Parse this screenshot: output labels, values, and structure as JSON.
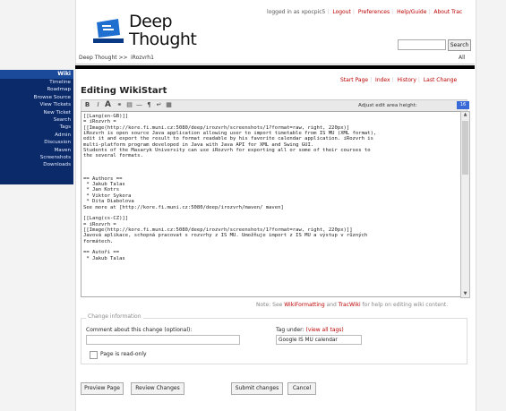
{
  "brand": {
    "line1": "Deep",
    "line2": "Thought"
  },
  "metanav": {
    "logged_in": "logged in as xpocpic5",
    "links": [
      "Logout",
      "Preferences",
      "Help/Guide",
      "About Trac"
    ]
  },
  "search": {
    "button": "Search"
  },
  "breadcrumb": {
    "first": "Deep Thought >>",
    "second": "iRozvrh1"
  },
  "all_button": "All",
  "sidebar": {
    "title": "Wiki",
    "items": [
      "Timeline",
      "Roadmap",
      "Browse Source",
      "View Tickets",
      "New Ticket",
      "Search",
      "Tags",
      "Admin",
      "Discussion",
      "Maven",
      "Screenshots",
      "Downloads"
    ]
  },
  "context_links": [
    "Start Page",
    "Index",
    "History",
    "Last Change"
  ],
  "page_title": "Editing WikiStart",
  "toolbar": {
    "icons": [
      "bold-icon",
      "italic-icon",
      "heading-icon",
      "link-icon",
      "code-icon",
      "hr-icon",
      "paragraph-icon",
      "linebreak-icon",
      "image-icon"
    ]
  },
  "adjust_label": "Adjust edit area height:",
  "adjust_value": "16",
  "editor_text": "[[Lang(en-GB)]]\n= iRozvrh =\n[[Image(http://kore.fi.muni.cz:5080/deep/irozvrh/screenshots/1?format=raw, right, 220px)]\niRozvrh is open source Java application allowing user to import timetable from IS MU (XML format),\nedit it and export the result to format readable by his favorite calendar application. iRozvrh is\nmulti-platform program developed in Java with Java API for XML and Swing GUI.\nStudents of the Masaryk University can use iRozvrh for exporting all or some of their courses to\nthe several formats.\n\n\n\n== Authors ==\n * Jakub Talas\n * Jan Kotrs\n * Viktor Sykora\n * Dita Diabolova\nSee more at [http://kore.fi.muni.cz:5080/deep/irozvrh/maven/ maven]\n\n[[Lang(cs-CZ)]]\n= iRozvrh =\n[[Image(http://kore.fi.muni.cz:5080/deep/irozvrh/screenshots/1?format=raw, right, 220px)]]\nJavová aplikace, schopná pracovat s rozvrhy z IS MU. Umožňuje import z IS MU a výstup v různých\nformátech.\n\n== Autoři ==\n * Jakub Talas",
  "note": {
    "prefix": "Note: See",
    "link1": "WikiFormatting",
    "middle": "and",
    "link2": "TracWiki",
    "suffix": "for help on editing wiki content."
  },
  "change_info": {
    "legend": "Change information",
    "comment_label": "Comment about this change (optional):",
    "tag_label": "Tag under:",
    "tag_link": "(view all tags)",
    "tag_value": "Google IS MU calendar",
    "readonly_label": "Page is read-only"
  },
  "buttons": {
    "preview": "Preview Page",
    "review": "Review Changes",
    "submit": "Submit changes",
    "cancel": "Cancel"
  }
}
